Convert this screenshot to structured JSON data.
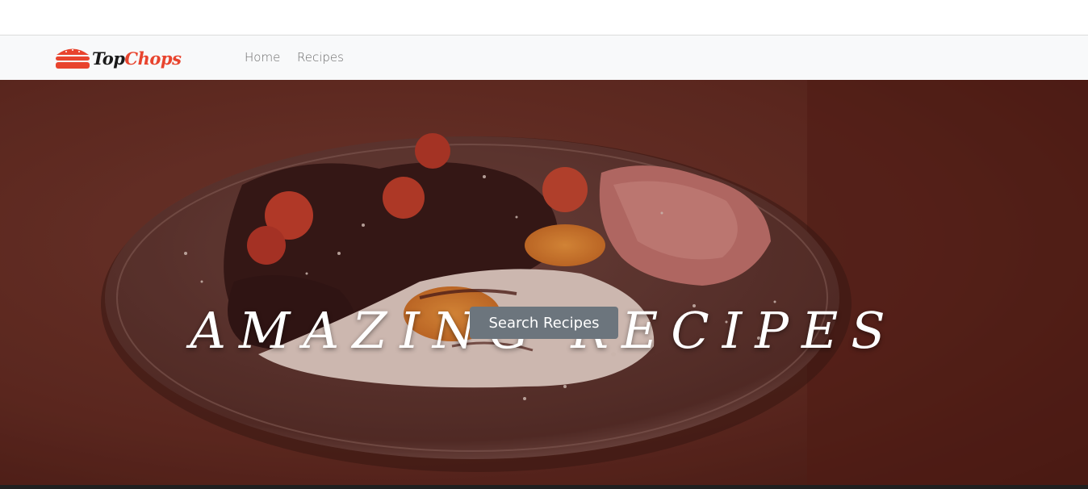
{
  "brand": {
    "name_part1": "Top",
    "name_part2": "Chops",
    "logo_icon": "burger-icon"
  },
  "nav": {
    "items": [
      {
        "label": "Home"
      },
      {
        "label": "Recipes"
      }
    ]
  },
  "hero": {
    "title": "AMAZING RECIPES",
    "button_label": "Search Recipes",
    "image": "plate-of-food-photo"
  },
  "colors": {
    "brand_accent": "#e8442e",
    "navbar_bg": "#f8f9fa",
    "button_bg": "#6c757d",
    "hero_tint": "#4a1f18"
  }
}
